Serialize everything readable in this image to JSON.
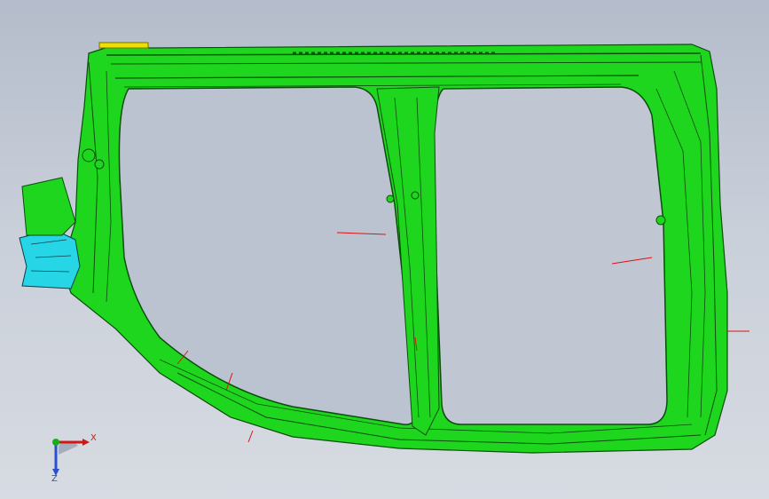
{
  "viewport": {
    "background_top": "#b4bccb",
    "background_bottom": "#d7dbe2"
  },
  "model": {
    "part_color": "#1fd61f",
    "edge_color": "#0b4d0b",
    "bracket_color": "#27d6e6",
    "pin_color": "#f0e000",
    "normal_color": "#e01010"
  },
  "triad": {
    "x_label": "X",
    "z_label": "Z",
    "x_color": "#d01818",
    "y_color": "#18b018",
    "z_color": "#2a4fd0"
  }
}
